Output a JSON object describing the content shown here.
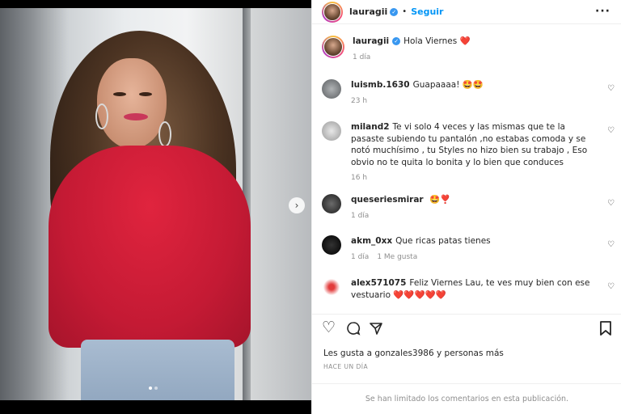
{
  "post": {
    "username": "lauragii",
    "follow_label": "Seguir",
    "separator": "•",
    "more_icon": "more-horizontal-icon",
    "caption_text": "Hola Viernes",
    "caption_emoji": "❤️",
    "caption_age": "1 día"
  },
  "comments": [
    {
      "user": "luismb.1630",
      "text": "Guapaaaa!",
      "emoji": "🤩🤩",
      "age": "23 h",
      "likes": ""
    },
    {
      "user": "miland2",
      "text": "Te vi solo 4 veces y las mismas que te la pasaste subiendo tu pantalón ,no estabas comoda y se notó muchísimo , tu Styles no hizo bien su trabajo , Eso obvio no te quita lo bonita y lo bien que conduces",
      "emoji": "",
      "age": "16 h",
      "likes": ""
    },
    {
      "user": "queseriesmirar",
      "text": "",
      "emoji": "🤩❣️",
      "age": "1 día",
      "likes": ""
    },
    {
      "user": "akm_0xx",
      "text": "Que ricas patas tienes",
      "emoji": "",
      "age": "1 día",
      "likes": "1 Me gusta"
    },
    {
      "user": "alex571075",
      "text": "Feliz Viernes Lau, te ves muy bien con ese vestuario",
      "emoji": "❤️❤️❤️❤️❤️",
      "age": "",
      "likes": ""
    }
  ],
  "actions": {
    "likes_text": "Les gusta a gonzales3986 y personas más",
    "timestamp": "HACE UN DÍA"
  },
  "footer": {
    "notice": "Se han limitado los comentarios en esta publicación."
  },
  "colors": {
    "accent": "#0095f6",
    "heart": "#ed4956",
    "verified": "#3897f0",
    "muted": "#8e8e8e"
  }
}
